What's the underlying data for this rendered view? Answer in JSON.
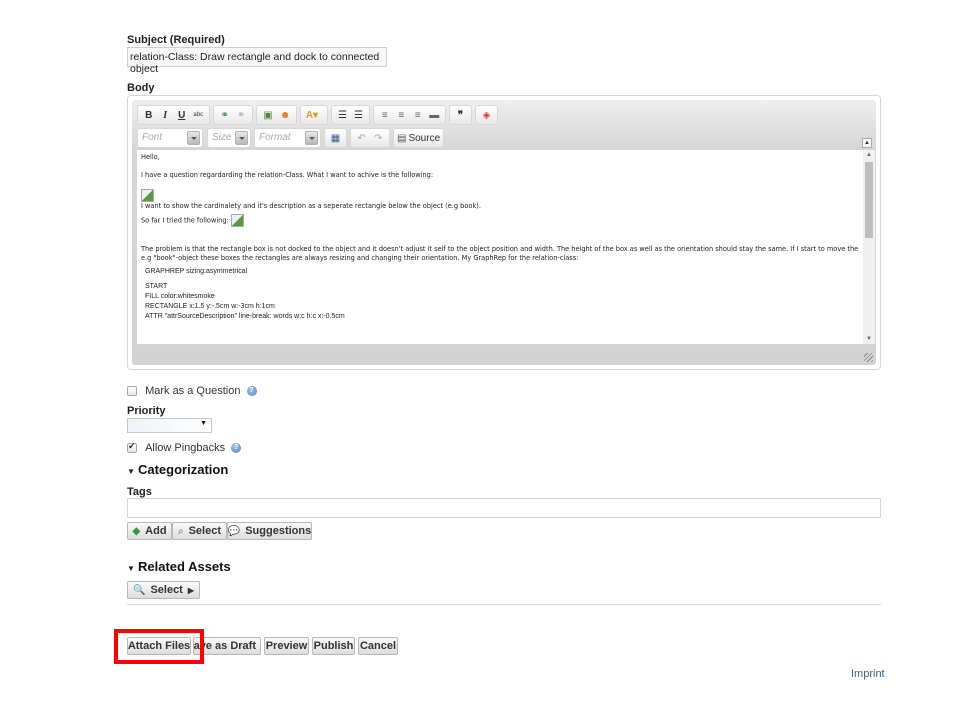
{
  "subject": {
    "label": "Subject (Required)",
    "value": "relation-Class: Draw rectangle and dock to connected object"
  },
  "body": {
    "label": "Body",
    "toolbar": {
      "row1": [
        {
          "icon": "bold-icon",
          "glyph": "B"
        },
        {
          "icon": "italic-icon",
          "glyph": "I"
        },
        {
          "icon": "underline-icon",
          "glyph": "U"
        },
        {
          "icon": "strikethrough-icon",
          "glyph": "abc"
        },
        {
          "icon": "link-icon",
          "glyph": "🔗"
        },
        {
          "icon": "unlink-icon",
          "glyph": "⛓"
        },
        {
          "icon": "image-icon",
          "glyph": "▣"
        },
        {
          "icon": "smiley-icon",
          "glyph": "☺"
        },
        {
          "icon": "text-color-icon",
          "glyph": "A"
        },
        {
          "icon": "numbered-list-icon",
          "glyph": "☰"
        },
        {
          "icon": "bulleted-list-icon",
          "glyph": "☰"
        },
        {
          "icon": "align-left-icon",
          "glyph": "≡"
        },
        {
          "icon": "align-center-icon",
          "glyph": "≡"
        },
        {
          "icon": "align-right-icon",
          "glyph": "≡"
        },
        {
          "icon": "justify-icon",
          "glyph": "■"
        },
        {
          "icon": "blockquote-icon",
          "glyph": "❞"
        },
        {
          "icon": "code-icon",
          "glyph": "◈"
        }
      ],
      "font_placeholder": "Font",
      "size_placeholder": "Size",
      "format_placeholder": "Format",
      "source_label": "Source"
    },
    "content": {
      "p1": "Hello,",
      "p2": "I have a question regardarding the relation-Class. What I want to achive is the following:",
      "p3": "I want to show the cardinalety and it's description as a seperate rectangle below the object (e.g book).",
      "p4": "So far I tried the following:",
      "p5": "The problem is that the rectangle box is not docked to the object and it doesn't adjust it self to the object position and width. The height of the box as well as the orientation should stay the same. If I start to move the e.g \"book\"-object these boxes the rectangles are always resizing and changing their orientation. My GraphRep for the relation-class:",
      "code1": "GRAPHREP  sizing:asymmetrical",
      "code2": "START",
      "code3": "FILL color:whitesmoke",
      "code4": "RECTANGLE x:1.5 y:-.5cm w:-3cm h:1cm",
      "code5": "ATTR \"attrSourceDescription\" line-break: words w:c h:c x:-0.5cm"
    }
  },
  "options": {
    "mark_question": {
      "label": "Mark as a Question",
      "checked": false
    },
    "priority": {
      "label": "Priority",
      "value": ""
    },
    "allow_pingbacks": {
      "label": "Allow Pingbacks",
      "checked": true
    }
  },
  "categorization": {
    "heading": "Categorization",
    "tags_label": "Tags",
    "tags_value": "",
    "buttons": {
      "add": "Add",
      "select": "Select",
      "suggestions": "Suggestions"
    }
  },
  "related_assets": {
    "heading": "Related Assets",
    "select_label": "Select"
  },
  "actions": {
    "attach_files": "Attach Files",
    "save_draft": "Save as Draft",
    "preview": "Preview",
    "publish": "Publish",
    "cancel": "Cancel"
  },
  "footer": {
    "imprint": "Imprint"
  },
  "colors": {
    "highlight": "#ff0000",
    "link": "#3d5f8a"
  }
}
